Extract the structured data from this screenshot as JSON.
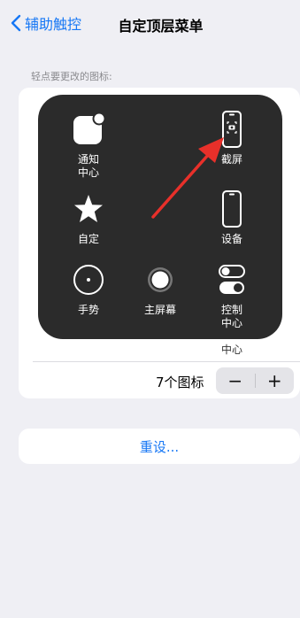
{
  "nav": {
    "back_label": "辅助触控",
    "title": "自定顶层菜单"
  },
  "section_label": "轻点要更改的图标:",
  "panel": {
    "items": [
      {
        "label": "通知\n中心",
        "icon": "notification-center-icon"
      },
      {
        "label": "截屏",
        "icon": "screenshot-icon"
      },
      {
        "label": "自定",
        "icon": "star-icon"
      },
      {
        "label": "设备",
        "icon": "device-icon"
      },
      {
        "label": "手势",
        "icon": "gesture-icon"
      },
      {
        "label": "主屏幕",
        "icon": "home-icon"
      },
      {
        "label": "控制\n中心",
        "icon": "control-center-icon"
      }
    ]
  },
  "below_label": "中心",
  "icon_count_label": "7个图标",
  "stepper": {
    "minus": "−",
    "plus": "+"
  },
  "reset_label": "重设...",
  "colors": {
    "accent": "#1677f5",
    "panel": "#2b2b2b",
    "arrow": "#e8302a",
    "background": "#efeff4"
  }
}
